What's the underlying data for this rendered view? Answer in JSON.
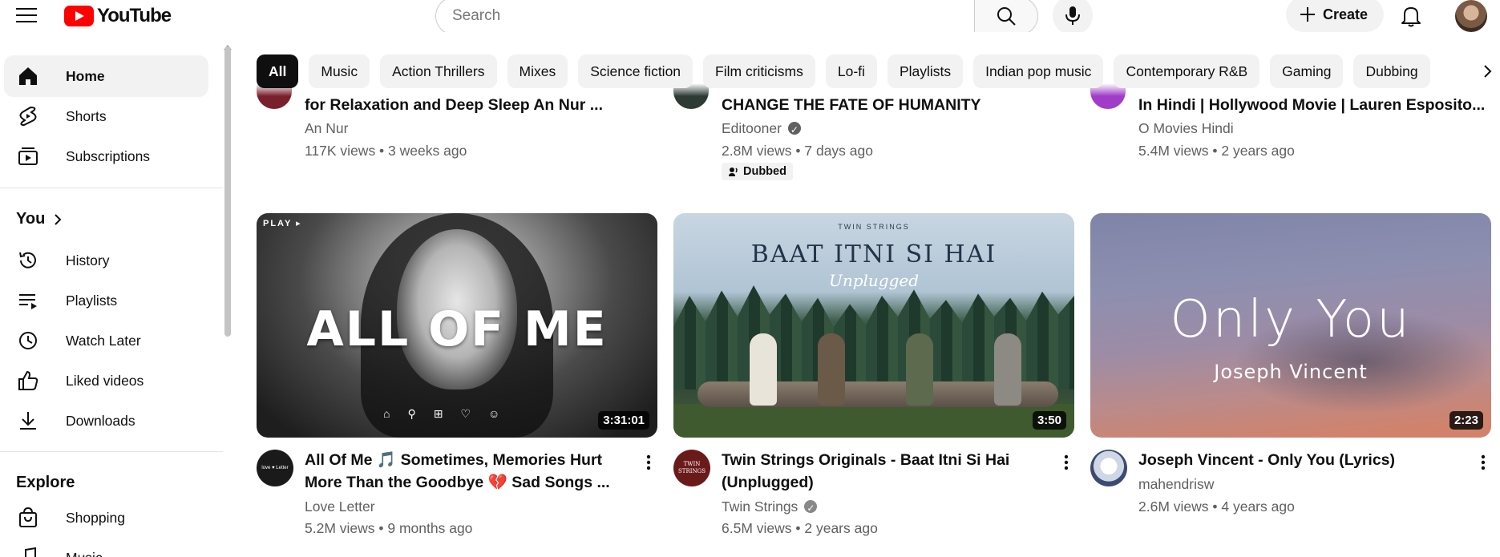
{
  "header": {
    "logo_text": "YouTube",
    "search_placeholder": "Search",
    "create_label": "Create"
  },
  "sidebar": {
    "main": [
      {
        "label": "Home",
        "icon": "home-icon",
        "active": true
      },
      {
        "label": "Shorts",
        "icon": "shorts-icon"
      },
      {
        "label": "Subscriptions",
        "icon": "subscriptions-icon"
      }
    ],
    "you_label": "You",
    "you_items": [
      {
        "label": "History",
        "icon": "history-icon"
      },
      {
        "label": "Playlists",
        "icon": "playlists-icon"
      },
      {
        "label": "Watch Later",
        "icon": "watch-later-icon"
      },
      {
        "label": "Liked videos",
        "icon": "liked-videos-icon"
      },
      {
        "label": "Downloads",
        "icon": "downloads-icon"
      }
    ],
    "explore_label": "Explore",
    "explore_items": [
      {
        "label": "Shopping",
        "icon": "shopping-icon"
      },
      {
        "label": "Music",
        "icon": "music-icon"
      }
    ]
  },
  "chips": [
    "All",
    "Music",
    "Action Thrillers",
    "Mixes",
    "Science fiction",
    "Film criticisms",
    "Lo-fi",
    "Playlists",
    "Indian pop music",
    "Contemporary R&B",
    "Gaming",
    "Dubbing"
  ],
  "top_row": [
    {
      "title": "for Relaxation and Deep Sleep An Nur ...",
      "channel": "An Nur",
      "stats": "117K views • 3 weeks ago"
    },
    {
      "title": "CHANGE THE FATE OF HUMANITY",
      "channel": "Editooner",
      "stats": "2.8M views • 7 days ago",
      "badge": "Dubbed"
    },
    {
      "title": "In Hindi | Hollywood Movie | Lauren Esposito...",
      "channel": "O Movies Hindi",
      "stats": "5.4M views • 2 years ago"
    }
  ],
  "videos": [
    {
      "title_line1": "All Of Me 🎵 Sometimes, Memories Hurt",
      "title_line2": "More Than the Goodbye 💔 Sad Songs ...",
      "channel": "Love Letter",
      "stats": "5.2M views • 9 months ago",
      "duration": "3:31:01",
      "thumb_text": "ALL OF ME",
      "thumb_tag": "PLAY ▸",
      "avatar_text": "love ♥ Letter"
    },
    {
      "title_line1": "Twin Strings Originals - Baat Itni Si Hai",
      "title_line2": "(Unplugged)",
      "channel": "Twin Strings",
      "stats": "6.5M views • 2 years ago",
      "duration": "3:50",
      "thumb_small": "TWIN STRINGS",
      "thumb_text": "BAAT ITNI SI HAI",
      "thumb_script": "Unplugged",
      "avatar_text": "TWIN STRINGS"
    },
    {
      "title_line1": "Joseph Vincent - Only You (Lyrics)",
      "title_line2": "",
      "channel": "mahendrisw",
      "stats": "2.6M views • 4 years ago",
      "duration": "2:23",
      "thumb_text": "Only You",
      "thumb_sub": "Joseph Vincent"
    }
  ]
}
